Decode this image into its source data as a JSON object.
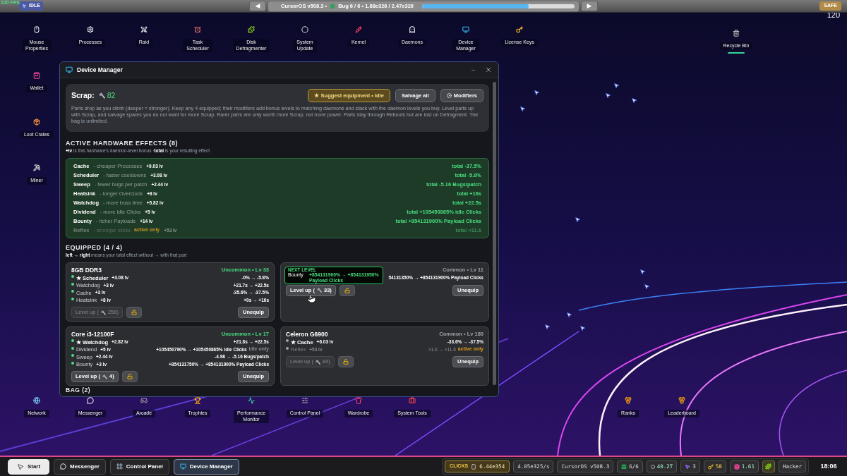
{
  "top_bar": {
    "fps": "120 FPS",
    "mode": "IDLE",
    "prev": "◀",
    "version": "CursorOS v508.3 •",
    "bug_status": "Bug 6 / 6 • 1.88e326 / 2.47e326",
    "progress": {
      "level": 0.7
    },
    "next": "▶",
    "safety": "SAFE",
    "counter": "120"
  },
  "desktop": {
    "top_row": [
      {
        "label": "Mouse\nProperties"
      },
      {
        "label": "Processes"
      },
      {
        "label": "Raid"
      },
      {
        "label": "Task\nScheduler"
      },
      {
        "label": "Disk\nDefragmenter"
      },
      {
        "label": "System\nUpdate"
      },
      {
        "label": "Kernel"
      },
      {
        "label": "Daemons"
      },
      {
        "label": "Device\nManager"
      },
      {
        "label": "License Keys"
      }
    ],
    "recycle_bin": {
      "label": "Recycle Bin"
    },
    "left_column": [
      {
        "label": "Wallet"
      },
      {
        "label": "Loot Crates"
      },
      {
        "label": "Miner"
      }
    ],
    "bottom_row": [
      {
        "label": "Network"
      },
      {
        "label": "Messenger"
      },
      {
        "label": "Arcade"
      },
      {
        "label": "Trophies"
      },
      {
        "label": "Performance\nMonitor"
      },
      {
        "label": "Control Panel"
      },
      {
        "label": "Wardrobe"
      },
      {
        "label": "System Tools"
      }
    ],
    "right_group": [
      {
        "label": "Ranks"
      },
      {
        "label": "Leaderboard"
      }
    ]
  },
  "window": {
    "title": "Device Manager",
    "scrap": {
      "label": "Scrap:",
      "amount": "82"
    },
    "actions": [
      {
        "label": "★ Suggest equipment • Idle",
        "kind": "suggest"
      },
      {
        "label": "Salvage all",
        "kind": "plain"
      },
      {
        "label": "Modifiers",
        "kind": "modifiers"
      }
    ],
    "description": "Parts drop as you climb (deeper = stronger). Keep any 4 equipped; their modifiers add bonus levels to matching daemons and stack with the daemon levels you buy. Level parts up with Scrap, and salvage spares you do not want for more Scrap. Rarer parts are only worth more Scrap, not more power. Parts stay through Reboots but are lost on Defragment. The bag is unlimited.",
    "effects": {
      "title": "ACTIVE HARDWARE EFFECTS (8)",
      "note": "**+lv** is this hardware's daemon-level bonus ·**total** is your resulting effect",
      "rows": [
        {
          "name": "Cache",
          "desc": "- cheaper Processes",
          "lv": "+9.03 lv",
          "total": "total -37.5%",
          "active": true
        },
        {
          "name": "Scheduler",
          "desc": "- faster cooldowns",
          "lv": "+3.08 lv",
          "total": "total -5.8%",
          "active": true
        },
        {
          "name": "Sweep",
          "desc": "- fewer bugs per patch",
          "lv": "+2.44 lv",
          "total": "total -5.16 Bugs/patch",
          "active": true
        },
        {
          "name": "Heatsink",
          "desc": "- longer Overclock",
          "lv": "+8 lv",
          "total": "total +16s",
          "active": true
        },
        {
          "name": "Watchdog",
          "desc": "- more boss time",
          "lv": "+5.82 lv",
          "total": "total +22.5s",
          "active": true
        },
        {
          "name": "Dividend",
          "desc": "- more idle Clicks",
          "lv": "+5 lv",
          "total": "total +105450865% idle Clicks",
          "active": true
        },
        {
          "name": "Bounty",
          "desc": "- richer Payloads",
          "lv": "+14 lv",
          "total": "total +854131900% Payload Clicks",
          "active": true
        },
        {
          "name": "Reflex",
          "desc": "- stronger clicks",
          "tag": {
            "text": "active only",
            "color": "#c9951f"
          },
          "lv": "+53 lv",
          "total": "total ×11.6",
          "active": false
        }
      ]
    },
    "equipped": {
      "title": "EQUIPPED (4 / 4)",
      "note": "**left → right** means your total effect without → with that part",
      "cards": [
        {
          "name": "8GB DDR3",
          "rarity": "Uncommon • Lv 33",
          "color": "#4ade80",
          "mods": [
            {
              "name": "★ Scheduler",
              "primary": true,
              "active": true,
              "lv": "+3.08 lv",
              "change": "-0% → -5.8%"
            },
            {
              "name": "Watchdog",
              "primary": false,
              "active": true,
              "lv": "+3 lv",
              "change": "+21.7s → +22.5s"
            },
            {
              "name": "Cache",
              "primary": false,
              "active": true,
              "lv": "+3 lv",
              "change": "-35.6% → -37.5%"
            },
            {
              "name": "Heatsink",
              "primary": false,
              "active": true,
              "lv": "+8 lv",
              "change": "+0s → +16s"
            }
          ],
          "level_up": {
            "label": "Level up (",
            "cost": "256)",
            "disabled": true
          },
          "unequip": "Unequip"
        },
        {
          "rarity": "Common • Lv 11",
          "color": "#a1a1aa",
          "tooltip": {
            "heading": "NEXT LEVEL",
            "name": "Bounty",
            "value": "+854131900% → +854131950% Payload Clicks"
          },
          "mods": [
            {
              "active": true,
              "change": "54131350% → +854131900% Payload Clicks"
            }
          ],
          "level_up": {
            "label": "Level up (",
            "cost": "33)",
            "disabled": false
          },
          "unequip": "Unequip"
        },
        {
          "name": "Core i3-12100F",
          "rarity": "Uncommon • Lv 17",
          "color": "#4ade80",
          "mods": [
            {
              "name": "★ Watchdog",
              "primary": true,
              "active": true,
              "lv": "+2.82 lv",
              "change": "+21.8s → +22.5s"
            },
            {
              "name": "Dividend",
              "primary": false,
              "active": true,
              "lv": "+5 lv",
              "change": "+105450790% → +105450865% idle Clicks",
              "tag": {
                "text": "idle only",
                "color": "#8b8d92"
              }
            },
            {
              "name": "Sweep",
              "primary": false,
              "active": true,
              "lv": "+2.44 lv",
              "change": "-4.98 → -5.16 Bugs/patch"
            },
            {
              "name": "Bounty",
              "primary": false,
              "active": true,
              "lv": "+3 lv",
              "change": "+854131750% → +854131900% Payload Clicks"
            }
          ],
          "level_up": {
            "label": "Level up (",
            "cost": "4)",
            "disabled": false
          },
          "unequip": "Unequip"
        },
        {
          "name": "Celeron G6900",
          "rarity": "Common • Lv 180",
          "color": "#a1a1aa",
          "mods": [
            {
              "name": "★ Cache",
              "primary": true,
              "active": true,
              "lv": "+6.03 lv",
              "change": "-33.6% → -37.5%"
            },
            {
              "name": "Reflex",
              "primary": false,
              "active": false,
              "lv": "+53 lv",
              "change": "×1.0 → ×11.6",
              "tag": {
                "text": "active only",
                "color": "#d99a1c"
              }
            }
          ],
          "level_up": {
            "label": "Level up (",
            "cost": "84)",
            "disabled": true
          },
          "unequip": "Unequip"
        }
      ]
    },
    "bag": {
      "title": "BAG (2)"
    }
  },
  "taskbar": {
    "start": "Start",
    "tasks": [
      {
        "label": "Messenger",
        "selected": false
      },
      {
        "label": "Control Panel",
        "selected": false
      },
      {
        "label": "Device Manager",
        "selected": true
      }
    ],
    "tray": {
      "clicks_label": "CLICKS",
      "clicks": "6.44e354",
      "rate": "4.05e325/s",
      "version": "CursorOS v508.3",
      "bugs": "6/6",
      "cycles": "40.2T",
      "cursors": "3",
      "keys": "58",
      "gems": "1.61",
      "rank": "Hacker"
    },
    "clock": "18:06"
  }
}
